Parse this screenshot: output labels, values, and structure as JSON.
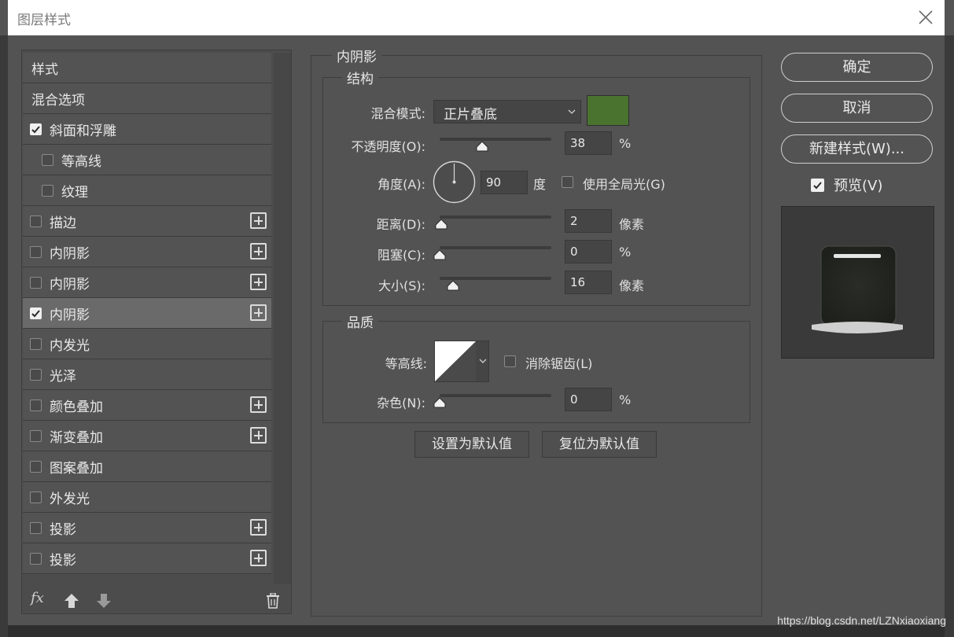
{
  "window": {
    "title": "图层样式"
  },
  "style_list": [
    {
      "label": "样式",
      "checkbox": null,
      "indent": 0,
      "plus": false,
      "selected": false
    },
    {
      "label": "混合选项",
      "checkbox": null,
      "indent": 0,
      "plus": false,
      "selected": false
    },
    {
      "label": "斜面和浮雕",
      "checkbox": true,
      "indent": 0,
      "plus": false,
      "selected": false
    },
    {
      "label": "等高线",
      "checkbox": false,
      "indent": 1,
      "plus": false,
      "selected": false
    },
    {
      "label": "纹理",
      "checkbox": false,
      "indent": 1,
      "plus": false,
      "selected": false
    },
    {
      "label": "描边",
      "checkbox": false,
      "indent": 0,
      "plus": true,
      "selected": false
    },
    {
      "label": "内阴影",
      "checkbox": false,
      "indent": 0,
      "plus": true,
      "selected": false
    },
    {
      "label": "内阴影",
      "checkbox": false,
      "indent": 0,
      "plus": true,
      "selected": false
    },
    {
      "label": "内阴影",
      "checkbox": true,
      "indent": 0,
      "plus": true,
      "selected": true
    },
    {
      "label": "内发光",
      "checkbox": false,
      "indent": 0,
      "plus": false,
      "selected": false
    },
    {
      "label": "光泽",
      "checkbox": false,
      "indent": 0,
      "plus": false,
      "selected": false
    },
    {
      "label": "颜色叠加",
      "checkbox": false,
      "indent": 0,
      "plus": true,
      "selected": false
    },
    {
      "label": "渐变叠加",
      "checkbox": false,
      "indent": 0,
      "plus": true,
      "selected": false
    },
    {
      "label": "图案叠加",
      "checkbox": false,
      "indent": 0,
      "plus": false,
      "selected": false
    },
    {
      "label": "外发光",
      "checkbox": false,
      "indent": 0,
      "plus": false,
      "selected": false
    },
    {
      "label": "投影",
      "checkbox": false,
      "indent": 0,
      "plus": true,
      "selected": false
    },
    {
      "label": "投影",
      "checkbox": false,
      "indent": 0,
      "plus": true,
      "selected": false
    }
  ],
  "bottom_tools": {
    "fx": "fx",
    "up_icon": "arrow-up-icon",
    "down_icon": "arrow-down-icon",
    "trash_icon": "trash-icon"
  },
  "inner_shadow": {
    "section_title": "内阴影",
    "structure_title": "结构",
    "blend_mode_label": "混合模式:",
    "blend_mode_value": "正片叠底",
    "shadow_color": "#4a7330",
    "opacity_label": "不透明度(O):",
    "opacity_value": "38",
    "opacity_unit": "%",
    "opacity_fraction": 0.38,
    "angle_label": "角度(A):",
    "angle_value": "90",
    "angle_unit": "度",
    "global_light_label": "使用全局光(G)",
    "global_light_checked": false,
    "distance_label": "距离(D):",
    "distance_value": "2",
    "distance_unit": "像素",
    "choke_label": "阻塞(C):",
    "choke_value": "0",
    "choke_unit": "%",
    "size_label": "大小(S):",
    "size_value": "16",
    "size_unit": "像素",
    "quality_title": "品质",
    "contour_label": "等高线:",
    "antialias_label": "消除锯齿(L)",
    "antialias_checked": false,
    "noise_label": "杂色(N):",
    "noise_value": "0",
    "noise_unit": "%",
    "set_default_label": "设置为默认值",
    "reset_default_label": "复位为默认值"
  },
  "actions": {
    "ok_label": "确定",
    "cancel_label": "取消",
    "new_style_label": "新建样式(W)...",
    "preview_label": "预览(V)",
    "preview_checked": true
  },
  "watermark": "https://blog.csdn.net/LZNxiaoxiang"
}
